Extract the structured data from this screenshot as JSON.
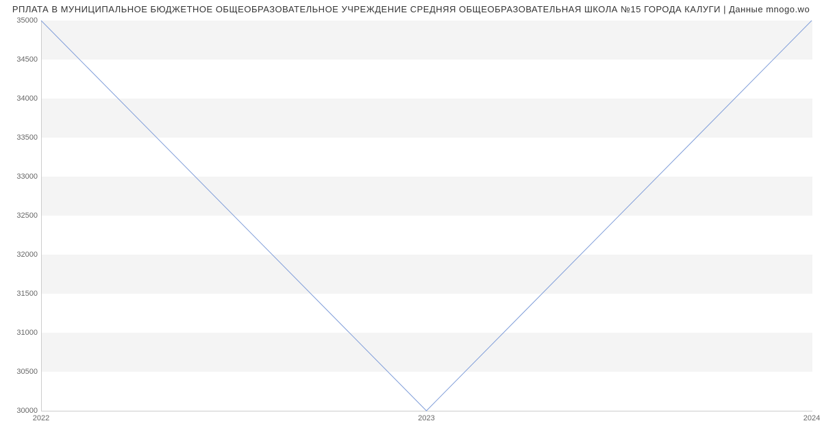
{
  "chart_data": {
    "type": "line",
    "title": "РПЛАТА В МУНИЦИПАЛЬНОЕ БЮДЖЕТНОЕ ОБЩЕОБРАЗОВАТЕЛЬНОЕ УЧРЕЖДЕНИЕ СРЕДНЯЯ ОБЩЕОБРАЗОВАТЕЛЬНАЯ ШКОЛА №15 ГОРОДА КАЛУГИ | Данные mnogo.wo",
    "x": [
      2022,
      2023,
      2024
    ],
    "values": [
      35000,
      30000,
      35000
    ],
    "x_ticks": [
      2022,
      2023,
      2024
    ],
    "y_ticks": [
      30000,
      30500,
      31000,
      31500,
      32000,
      32500,
      33000,
      33500,
      34000,
      34500,
      35000
    ],
    "xlim": [
      2022,
      2024
    ],
    "ylim": [
      30000,
      35000
    ],
    "line_color": "#7f9dd9",
    "grid_band_color": "#f4f4f4"
  }
}
